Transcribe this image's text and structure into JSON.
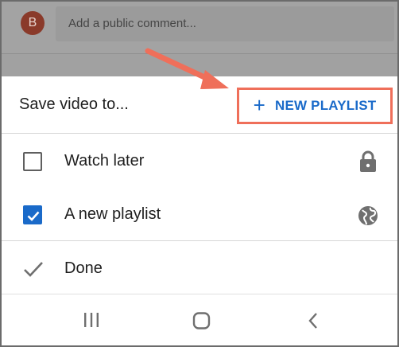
{
  "background": {
    "avatar_initial": "B",
    "comment_placeholder": "Add a public comment..."
  },
  "sheet": {
    "title": "Save video to...",
    "new_playlist_label": "NEW PLAYLIST",
    "new_playlist_icon": "plus-icon",
    "items": [
      {
        "label": "Watch later",
        "checked": false,
        "privacy_icon": "lock-icon"
      },
      {
        "label": "A new playlist",
        "checked": true,
        "privacy_icon": "globe-icon"
      }
    ],
    "done_label": "Done"
  },
  "navbar": {
    "buttons": [
      "recent-apps-icon",
      "home-icon",
      "back-icon"
    ]
  },
  "colors": {
    "accent_blue": "#1a6ac9",
    "highlight_red": "#ef6f5a",
    "dim_overlay": "#a3a3a3"
  }
}
